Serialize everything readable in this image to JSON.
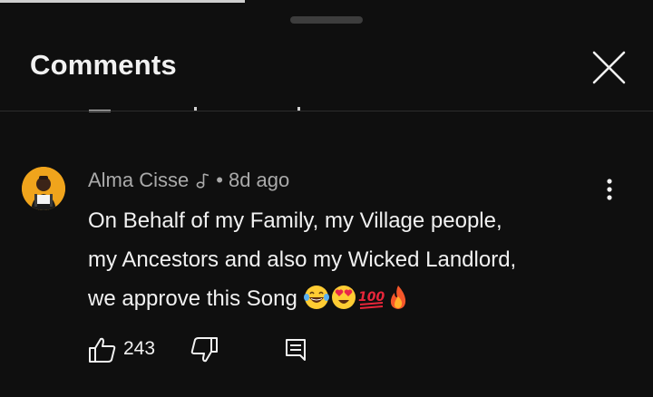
{
  "header": {
    "title": "Comments",
    "close_icon": "close-icon"
  },
  "comment": {
    "author": "Alma Cisse",
    "author_badge_icon": "music-note-icon",
    "separator": "•",
    "time": "8d ago",
    "lines": [
      "On Behalf of my Family, my Village people,",
      "my Ancestors and also my Wicked Landlord,",
      "we approve this Song"
    ],
    "emojis": [
      "laughing-tears-emoji",
      "heart-eyes-emoji",
      "hundred-points-emoji",
      "fire-emoji"
    ],
    "likes": "243",
    "avatar_bg": "#f0a41c"
  },
  "actions": {
    "like_icon": "thumbs-up-icon",
    "dislike_icon": "thumbs-down-icon",
    "reply_icon": "reply-icon",
    "menu_icon": "more-vert-icon"
  }
}
